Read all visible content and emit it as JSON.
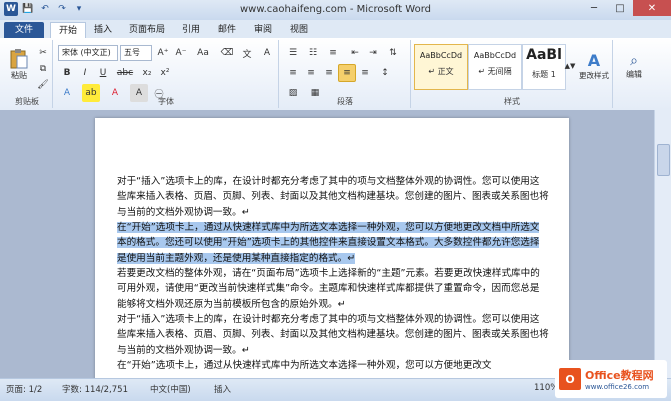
{
  "window": {
    "title": "www.caohaifeng.com - Microsoft Word",
    "minimize": "─",
    "maximize": "□",
    "close": "✕"
  },
  "qat": {
    "save": "💾",
    "undo": "↶",
    "redo": "↷",
    "customize": "▾"
  },
  "tabs": [
    {
      "label": "文件"
    },
    {
      "label": "开始"
    },
    {
      "label": "插入"
    },
    {
      "label": "页面布局"
    },
    {
      "label": "引用"
    },
    {
      "label": "邮件"
    },
    {
      "label": "审阅"
    },
    {
      "label": "视图"
    }
  ],
  "ribbon": {
    "clipboard": {
      "paste": "粘贴",
      "label": "剪贴板"
    },
    "font": {
      "font_name": "宋体 (中文正)",
      "font_size": "五号",
      "label": "字体"
    },
    "paragraph": {
      "label": "段落"
    },
    "styles": {
      "label": "样式",
      "items": [
        {
          "sample": "AaBbCcDd",
          "name": "↵ 正文"
        },
        {
          "sample": "AaBbCcDd",
          "name": "↵ 无间隔"
        },
        {
          "sample": "AaBl",
          "name": "标题 1"
        }
      ],
      "change_styles": "更改样式"
    },
    "editing": {
      "label": "编辑"
    }
  },
  "document": {
    "paragraphs": [
      {
        "text": "对于“插入”选项卡上的库，在设计时都充分考虑了其中的项与文档整体外观的协调性。您可以使用这些库来插入表格、页眉、页脚、列表、封面以及其他文档构建基块。您创建的图片、图表或关系图也将与当前的文档外观协调一致。↵",
        "highlight": false
      },
      {
        "text": "在“开始”选项卡上，通过从快速样式库中为所选文本选择一种外观，您可以方便地更改文档中所选文本的格式。您还可以使用“开始”选项卡上的其他控件来直接设置文本格式。大多数控件都允许您选择是使用当前主题外观，还是使用某种直接指定的格式。↵",
        "highlight": true
      },
      {
        "text": "若要更改文档的整体外观，请在“页面布局”选项卡上选择新的“主题”元素。若要更改快速样式库中的可用外观，请使用“更改当前快速样式集”命令。主题库和快速样式库都提供了重置命令，因而您总是能够将文档外观还原为当前模板所包含的原始外观。↵",
        "highlight": false
      },
      {
        "text": "对于“插入”选项卡上的库，在设计时都充分考虑了其中的项与文档整体外观的协调性。您可以使用这些库来插入表格、页眉、页脚、列表、封面以及其他文档构建基块。您创建的图片、图表或关系图也将与当前的文档外观协调一致。↵",
        "highlight": false
      },
      {
        "text": "在“开始”选项卡上，通过从快速样式库中为所选文本选择一种外观，您可以方便地更改文",
        "highlight": false
      }
    ]
  },
  "status": {
    "page": "页面: 1/2",
    "words": "字数: 114/2,751",
    "language": "中文(中国)",
    "mode": "插入",
    "zoom": "110%"
  },
  "watermark": {
    "line1": "Office教程网",
    "line2": "www.office26.com"
  }
}
